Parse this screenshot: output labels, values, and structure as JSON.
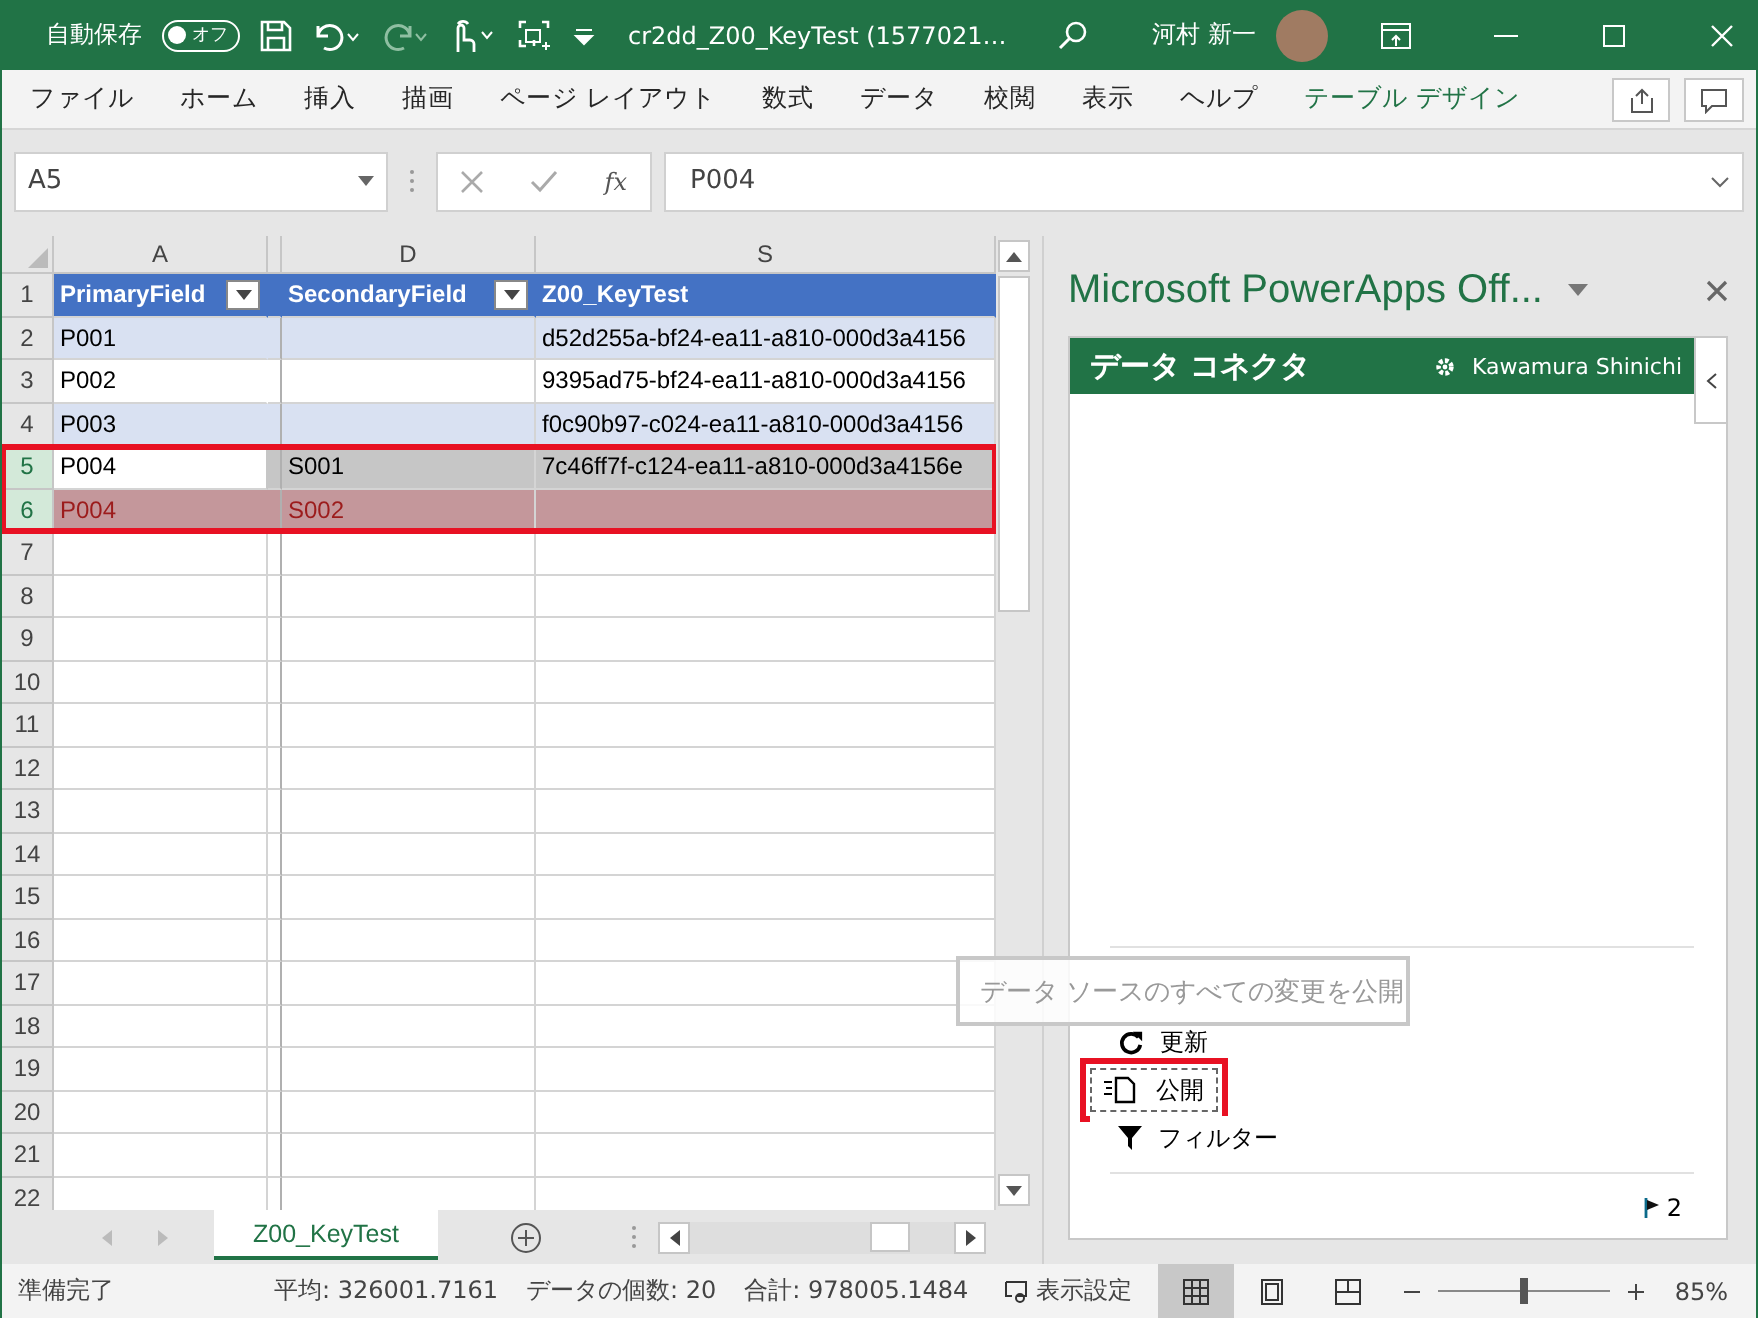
{
  "title_bar": {
    "autosave_label": "自動保存",
    "autosave_toggle": {
      "text": "オフ",
      "on": false
    },
    "document_title": "cr2dd_Z00_KeyTest (1577021…",
    "user_name": "河村 新一"
  },
  "ribbon_tabs": [
    {
      "label": "ファイル",
      "contextual": false
    },
    {
      "label": "ホーム",
      "contextual": false
    },
    {
      "label": "挿入",
      "contextual": false
    },
    {
      "label": "描画",
      "contextual": false
    },
    {
      "label": "ページ レイアウト",
      "contextual": false
    },
    {
      "label": "数式",
      "contextual": false
    },
    {
      "label": "データ",
      "contextual": false
    },
    {
      "label": "校閲",
      "contextual": false
    },
    {
      "label": "表示",
      "contextual": false
    },
    {
      "label": "ヘルプ",
      "contextual": false
    },
    {
      "label": "テーブル デザイン",
      "contextual": true
    }
  ],
  "formula_bar": {
    "name_box": "A5",
    "function_label": "fx",
    "value": "P004"
  },
  "sheet": {
    "columns": [
      "A",
      "D",
      "S"
    ],
    "table_header": {
      "row_number": "1",
      "fields": [
        {
          "label": "PrimaryField",
          "filter": true
        },
        {
          "label": "SecondaryField",
          "filter": true
        },
        {
          "label": "Z00_KeyTest",
          "filter": false
        }
      ]
    },
    "rows": [
      {
        "number": "2",
        "kind": "band",
        "selected": false,
        "outlined": false,
        "primary": "P001",
        "key": "d52d255a-bf24-ea11-a810-000d3a4156"
      },
      {
        "number": "3",
        "kind": "plain",
        "selected": false,
        "outlined": false,
        "primary": "P002",
        "key": "9395ad75-bf24-ea11-a810-000d3a4156"
      },
      {
        "number": "4",
        "kind": "band",
        "selected": false,
        "outlined": false,
        "primary": "P003",
        "key": "f0c90b97-c024-ea11-a810-000d3a4156"
      },
      {
        "number": "5",
        "kind": "active",
        "selected": true,
        "outlined": true,
        "primary": "P004",
        "secondary": "S001",
        "key": "7c46ff7f-c124-ea11-a810-000d3a4156e"
      },
      {
        "number": "6",
        "kind": "error",
        "selected": true,
        "outlined": true,
        "primary": "P004",
        "secondary": "S002"
      }
    ],
    "empty_rows": [
      "7",
      "8",
      "9",
      "10",
      "11",
      "12",
      "13",
      "14",
      "15",
      "16",
      "17",
      "18",
      "19",
      "20",
      "21",
      "22"
    ]
  },
  "side_pane": {
    "title": "Microsoft PowerApps Off...",
    "header": "データ コネクタ",
    "account": "Kawamura Shinichi",
    "tooltip": "データ ソースのすべての変更を公開",
    "actions": [
      {
        "label": "更新",
        "kind": "refresh",
        "outlined": false
      },
      {
        "label": "公開",
        "kind": "publish",
        "outlined": true
      },
      {
        "label": "フィルター",
        "kind": "filter",
        "outlined": false
      }
    ],
    "flag_count": "2"
  },
  "sheet_tabs": [
    {
      "label": "Z00_KeyTest",
      "selected": true
    }
  ],
  "status_bar": {
    "state": "準備完了",
    "average": "平均: 326001.7161",
    "count": "データの個数: 20",
    "sum": "合計: 978005.1484",
    "display_settings": "表示設定",
    "views": [
      {
        "kind": "normal",
        "selected": true
      },
      {
        "kind": "page-layout",
        "selected": false
      },
      {
        "kind": "page-break",
        "selected": false
      }
    ],
    "zoom": {
      "level": 0.5,
      "reading": "85%"
    }
  }
}
